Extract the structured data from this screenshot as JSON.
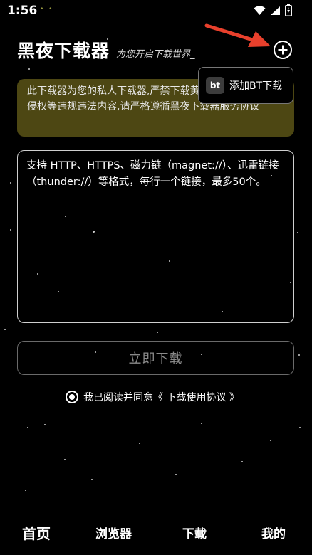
{
  "status_bar": {
    "time": "1:56"
  },
  "header": {
    "title": "黑夜下载器",
    "subtitle": "为您开启下载世界_"
  },
  "popup_menu": {
    "badge": "bt",
    "item_label": "添加BT下载"
  },
  "notice": {
    "text": "此下载器为您的私人下载器,严禁下载黄、赌、毒、暴力、侵权等违规违法内容,请严格遵循黑夜下载器服务协议"
  },
  "links_input": {
    "value": "",
    "placeholder": "支持 HTTP、HTTPS、磁力链（magnet://）、迅雷链接（thunder://）等格式，每行一个链接，最多50个。"
  },
  "download_button": {
    "label": "立即下载"
  },
  "agreement": {
    "text": "我已阅读并同意《 下载使用协议 》",
    "checked": true
  },
  "bottom_nav": {
    "items": [
      {
        "label": "首页",
        "active": true
      },
      {
        "label": "浏览器",
        "active": false
      },
      {
        "label": "下载",
        "active": false
      },
      {
        "label": "我的",
        "active": false
      }
    ]
  },
  "colors": {
    "background": "#000000",
    "notice_bg": "#4d4713",
    "arrow": "#e8402c"
  },
  "icons": [
    "wifi-icon",
    "signal-icon",
    "battery-icon",
    "plus-circle-icon",
    "bt-icon",
    "radio-checked-icon",
    "pointer-arrow"
  ]
}
